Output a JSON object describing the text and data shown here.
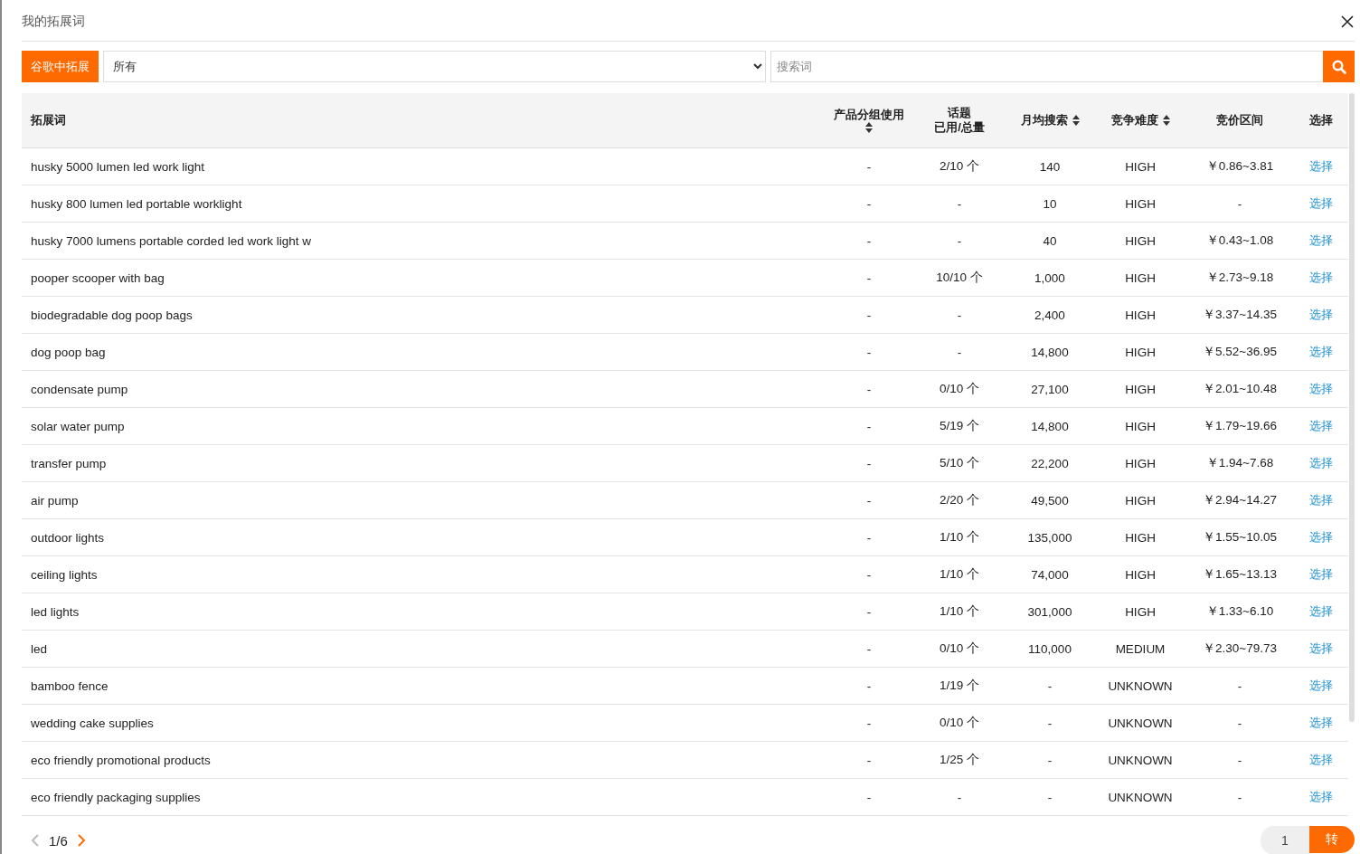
{
  "dialog": {
    "title": "我的拓展词"
  },
  "toolbar": {
    "expand_button": "谷歌中拓展",
    "category_select": {
      "value": "所有"
    },
    "search": {
      "placeholder": "搜索词"
    }
  },
  "table": {
    "columns": [
      {
        "kind": "plain",
        "label": "拓展词"
      },
      {
        "kind": "sort_below",
        "label": "产品分组使用"
      },
      {
        "kind": "two_line",
        "label": "话题",
        "label_2": "已用/总量"
      },
      {
        "kind": "sortable",
        "label": "月均搜索"
      },
      {
        "kind": "sortable",
        "label": "竞争难度"
      },
      {
        "kind": "plain",
        "label": "竞价区间"
      },
      {
        "kind": "plain",
        "label": "选择"
      }
    ],
    "rows": [
      {
        "keyword": "husky 5000 lumen led work light",
        "group_use": "-",
        "topics": "2/10 个",
        "monthly": "140",
        "competition": "HIGH",
        "bid": "￥0.86~3.81",
        "action": "选择"
      },
      {
        "keyword": "husky 800 lumen led portable worklight",
        "group_use": "-",
        "topics": "-",
        "monthly": "10",
        "competition": "HIGH",
        "bid": "-",
        "action": "选择"
      },
      {
        "keyword": "husky 7000 lumens portable corded led work light w",
        "group_use": "-",
        "topics": "-",
        "monthly": "40",
        "competition": "HIGH",
        "bid": "￥0.43~1.08",
        "action": "选择"
      },
      {
        "keyword": "pooper scooper with bag",
        "group_use": "-",
        "topics": "10/10 个",
        "monthly": "1,000",
        "competition": "HIGH",
        "bid": "￥2.73~9.18",
        "action": "选择"
      },
      {
        "keyword": "biodegradable dog poop bags",
        "group_use": "-",
        "topics": "-",
        "monthly": "2,400",
        "competition": "HIGH",
        "bid": "￥3.37~14.35",
        "action": "选择"
      },
      {
        "keyword": "dog poop bag",
        "group_use": "-",
        "topics": "-",
        "monthly": "14,800",
        "competition": "HIGH",
        "bid": "￥5.52~36.95",
        "action": "选择"
      },
      {
        "keyword": "condensate pump",
        "group_use": "-",
        "topics": "0/10 个",
        "monthly": "27,100",
        "competition": "HIGH",
        "bid": "￥2.01~10.48",
        "action": "选择"
      },
      {
        "keyword": "solar water pump",
        "group_use": "-",
        "topics": "5/19 个",
        "monthly": "14,800",
        "competition": "HIGH",
        "bid": "￥1.79~19.66",
        "action": "选择"
      },
      {
        "keyword": "transfer pump",
        "group_use": "-",
        "topics": "5/10 个",
        "monthly": "22,200",
        "competition": "HIGH",
        "bid": "￥1.94~7.68",
        "action": "选择"
      },
      {
        "keyword": "air pump",
        "group_use": "-",
        "topics": "2/20 个",
        "monthly": "49,500",
        "competition": "HIGH",
        "bid": "￥2.94~14.27",
        "action": "选择"
      },
      {
        "keyword": "outdoor lights",
        "group_use": "-",
        "topics": "1/10 个",
        "monthly": "135,000",
        "competition": "HIGH",
        "bid": "￥1.55~10.05",
        "action": "选择"
      },
      {
        "keyword": "ceiling lights",
        "group_use": "-",
        "topics": "1/10 个",
        "monthly": "74,000",
        "competition": "HIGH",
        "bid": "￥1.65~13.13",
        "action": "选择"
      },
      {
        "keyword": "led lights",
        "group_use": "-",
        "topics": "1/10 个",
        "monthly": "301,000",
        "competition": "HIGH",
        "bid": "￥1.33~6.10",
        "action": "选择"
      },
      {
        "keyword": "led",
        "group_use": "-",
        "topics": "0/10 个",
        "monthly": "110,000",
        "competition": "MEDIUM",
        "bid": "￥2.30~79.73",
        "action": "选择"
      },
      {
        "keyword": "bamboo fence",
        "group_use": "-",
        "topics": "1/19 个",
        "monthly": "-",
        "competition": "UNKNOWN",
        "bid": "-",
        "action": "选择"
      },
      {
        "keyword": "wedding cake supplies",
        "group_use": "-",
        "topics": "0/10 个",
        "monthly": "-",
        "competition": "UNKNOWN",
        "bid": "-",
        "action": "选择"
      },
      {
        "keyword": "eco friendly promotional products",
        "group_use": "-",
        "topics": "1/25 个",
        "monthly": "-",
        "competition": "UNKNOWN",
        "bid": "-",
        "action": "选择"
      },
      {
        "keyword": "eco friendly packaging supplies",
        "group_use": "-",
        "topics": "-",
        "monthly": "-",
        "competition": "UNKNOWN",
        "bid": "-",
        "action": "选择"
      }
    ]
  },
  "pagination": {
    "prev_disabled": true,
    "next_disabled": false,
    "page": "1/6",
    "jump_value": "1",
    "jump_button": "转"
  }
}
